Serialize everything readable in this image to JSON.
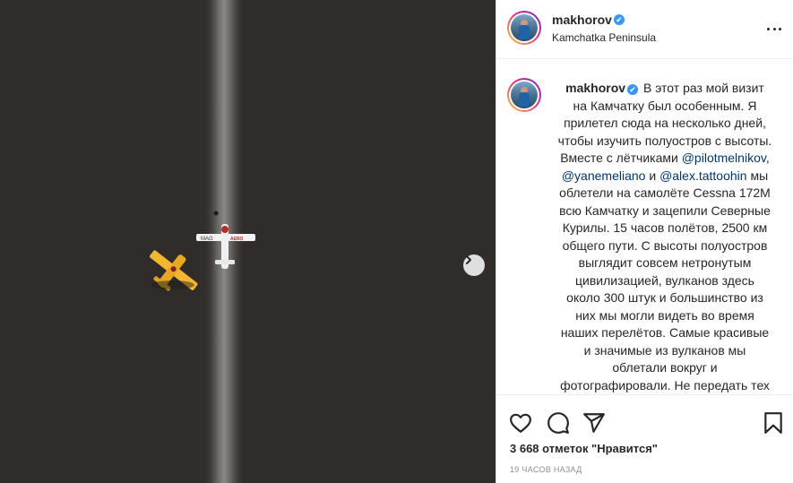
{
  "post": {
    "author": "makhorov",
    "location": "Kamchatka Peninsula",
    "verified_glyph": "✔",
    "caption": {
      "text_1": " В этот раз мой визит на Камчатку был особенным. Я прилетел сюда на несколько дней, чтобы изучить полуостров с высоты. Вместе с лётчиками ",
      "mention_1": "@pilotmelnikov",
      "text_2": ", ",
      "mention_2": "@yanemeliano",
      "text_3": " и ",
      "mention_3": "@alex.tattoohin",
      "text_4": " мы облетели на самолёте Cessna 172M всю Камчатку и зацепили Северные Курилы. 15 часов полётов, 2500 км общего пути. С высоты полуостров выглядит совсем нетронутым цивилизацией, вулканов здесь около 300 штук и большинство из них мы могли видеть во время наших перелётов. Самые красивые и значимые из вулканов мы облетали вокруг и фотографировали. Не передать тех ощущений, когда пролетаешь в нескольких метрах от кратера Авачинского вулкана или"
    },
    "likes": "3 668 отметок \"Нравится\"",
    "time_ago": "19 ЧАСОВ НАЗАД",
    "plane_label": "MAG",
    "plane_label_2": "AERO"
  },
  "icons": {
    "more": "more-options-icon",
    "like": "heart-icon",
    "comment": "comment-icon",
    "share": "share-icon",
    "save": "bookmark-icon",
    "next": "chevron-right-icon"
  },
  "colors": {
    "verified": "#3897f0",
    "mention": "#00376b",
    "meta": "#8e8e8e",
    "ground": "#2f2c2a",
    "plane_yellow": "#f2b632"
  }
}
